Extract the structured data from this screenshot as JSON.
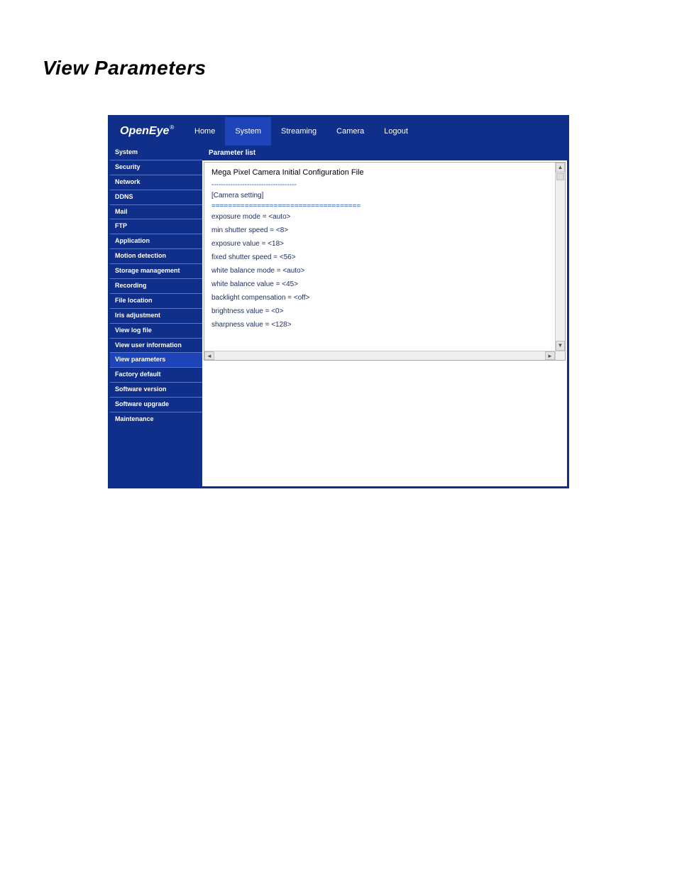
{
  "page_title": "View Parameters",
  "brand": "OpenEye",
  "tabs": [
    "Home",
    "System",
    "Streaming",
    "Camera",
    "Logout"
  ],
  "active_tab_index": 1,
  "sidebar": {
    "items": [
      "System",
      "Security",
      "Network",
      "DDNS",
      "Mail",
      "FTP",
      "Application",
      "Motion detection",
      "Storage management",
      "Recording",
      "File location",
      "Iris adjustment",
      "View log file",
      "View user information",
      "View parameters",
      "Factory default",
      "Software version",
      "Software upgrade",
      "Maintenance"
    ],
    "active_index": 14
  },
  "panel": {
    "header": "Parameter list",
    "title_line": "Mega Pixel Camera Initial Configuration File",
    "separator": "------------------------------------",
    "section_label": "[Camera setting]",
    "double_separator": "====================================",
    "lines": [
      "exposure mode = <auto>",
      "min shutter speed = <8>",
      "exposure value = <18>",
      "fixed shutter speed = <56>",
      "white balance mode = <auto>",
      "white balance value = <45>",
      "backlight compensation = <off>",
      "brightness value = <0>",
      "sharpness value = <128>"
    ]
  }
}
